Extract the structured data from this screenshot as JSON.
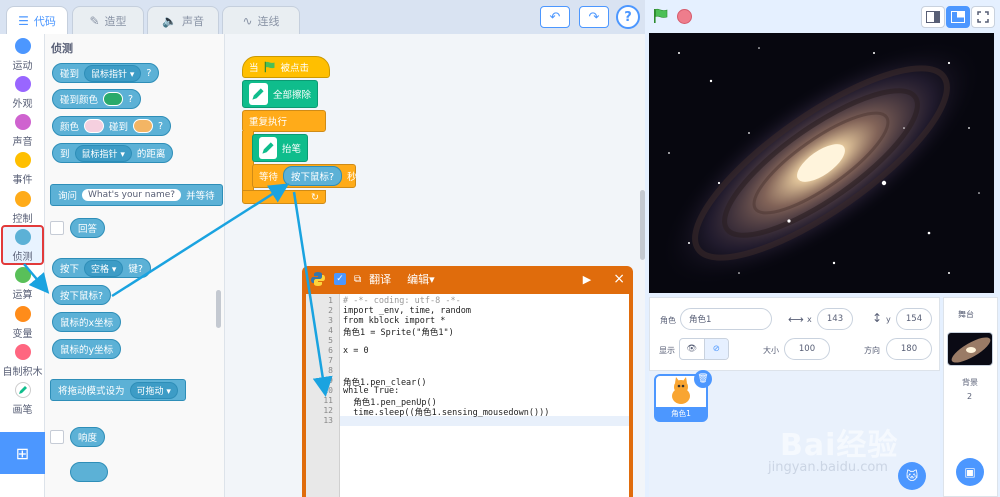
{
  "tabs": [
    {
      "label": "代码",
      "icon": "code-icon"
    },
    {
      "label": "造型",
      "icon": "brush-icon"
    },
    {
      "label": "声音",
      "icon": "speaker-icon"
    },
    {
      "label": "连线",
      "icon": "link-icon"
    }
  ],
  "toolbar": {
    "undo": "↶",
    "redo": "↷",
    "help": "?"
  },
  "categories": [
    {
      "label": "运动",
      "color": "#4c97ff"
    },
    {
      "label": "外观",
      "color": "#9966ff"
    },
    {
      "label": "声音",
      "color": "#cf63cf"
    },
    {
      "label": "事件",
      "color": "#ffbf00"
    },
    {
      "label": "控制",
      "color": "#ffab19"
    },
    {
      "label": "侦测",
      "color": "#5cb1d6"
    },
    {
      "label": "运算",
      "color": "#59c059"
    },
    {
      "label": "变量",
      "color": "#ff8c1a"
    },
    {
      "label": "自制积木",
      "color": "#ff6680"
    },
    {
      "label": "画笔",
      "color": "#0fbd8c"
    }
  ],
  "palette": {
    "title": "侦测",
    "touching": {
      "pre": "碰到",
      "drop": "鼠标指针",
      "post": "?"
    },
    "touching_color": {
      "pre": "碰到颜色",
      "post": "?"
    },
    "color_touching": {
      "pre": "颜色",
      "mid": "碰到",
      "post": "?"
    },
    "distance": {
      "pre": "到",
      "drop": "鼠标指针",
      "post": "的距离"
    },
    "ask": {
      "pre": "询问",
      "field": "What's your name?",
      "post": "并等待"
    },
    "answer": "回答",
    "key_pressed": {
      "pre": "按下",
      "drop": "空格",
      "post": "键?"
    },
    "mouse_down": "按下鼠标?",
    "mouse_x": "鼠标的x坐标",
    "mouse_y": "鼠标的y坐标",
    "drag_mode": {
      "pre": "将拖动模式设为",
      "drop": "可拖动"
    },
    "loudness": "响度"
  },
  "script": {
    "when_clicked": {
      "pre": "当",
      "post": "被点击"
    },
    "clear": "全部擦除",
    "forever": "重复执行",
    "pen_up": "抬笔",
    "wait": {
      "pre": "等待",
      "reporter": "按下鼠标?",
      "post": "秒"
    }
  },
  "python": {
    "translate": "翻译",
    "edit": "编辑",
    "close": "×",
    "lines": [
      {
        "n": "1",
        "text": "# -*- coding: utf-8 -*-"
      },
      {
        "n": "2",
        "text": "import _env, time, random"
      },
      {
        "n": "3",
        "text": "from kblock import *"
      },
      {
        "n": "4",
        "text": "角色1 = Sprite(\"角色1\")"
      },
      {
        "n": "5",
        "text": ""
      },
      {
        "n": "6",
        "text": "x = 0"
      },
      {
        "n": "7",
        "text": ""
      },
      {
        "n": "8",
        "text": ""
      },
      {
        "n": "9",
        "text": "角色1.pen_clear()"
      },
      {
        "n": "10",
        "text": "while True:"
      },
      {
        "n": "11",
        "text": "  角色1.pen_penUp()"
      },
      {
        "n": "12",
        "text": "  time.sleep((角色1.sensing_mousedown()))"
      },
      {
        "n": "13",
        "text": ""
      }
    ]
  },
  "sprite_info": {
    "sprite_label": "角色",
    "sprite_name": "角色1",
    "x_label": "x",
    "x_value": "143",
    "y_label": "y",
    "y_value": "154",
    "show_label": "显示",
    "size_label": "大小",
    "size_value": "100",
    "direction_label": "方向",
    "direction_value": "180"
  },
  "sprite_thumb": "角色1",
  "stage_panel": {
    "title": "舞台",
    "backdrop_label": "背景",
    "backdrop_count": "2"
  },
  "watermark": {
    "main": "Bai经验",
    "sub": "jingyan.baidu.com"
  }
}
